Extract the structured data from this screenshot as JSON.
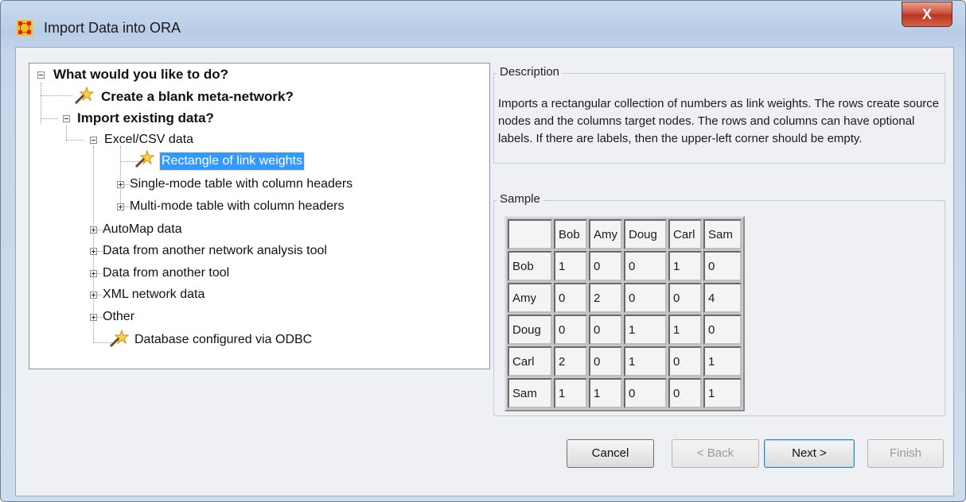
{
  "window": {
    "title": "Import Data into ORA",
    "close_label": "X"
  },
  "tree": {
    "root": "What would you like to do?",
    "create_blank": "Create a blank meta-network?",
    "import_existing": "Import existing data?",
    "excel_csv": "Excel/CSV data",
    "rect_link_weights": "Rectangle of link weights",
    "single_mode": "Single-mode table with column headers",
    "multi_mode": "Multi-mode table with column headers",
    "automap": "AutoMap data",
    "other_network_tool": "Data from another network analysis tool",
    "other_tool": "Data from another tool",
    "xml_network": "XML network data",
    "other": "Other",
    "odbc": "Database configured via ODBC"
  },
  "description": {
    "label": "Description",
    "text": "Imports a rectangular collection of numbers as link weights. The rows create source nodes and the columns target nodes. The rows and columns can have optional labels. If there are labels, then the upper-left corner should be empty."
  },
  "sample": {
    "label": "Sample",
    "columns": [
      "",
      "Bob",
      "Amy",
      "Doug",
      "Carl",
      "Sam"
    ],
    "rows": [
      [
        "Bob",
        "1",
        "0",
        "0",
        "1",
        "0"
      ],
      [
        "Amy",
        "0",
        "2",
        "0",
        "0",
        "4"
      ],
      [
        "Doug",
        "0",
        "0",
        "1",
        "1",
        "0"
      ],
      [
        "Carl",
        "2",
        "0",
        "1",
        "0",
        "1"
      ],
      [
        "Sam",
        "1",
        "1",
        "0",
        "0",
        "1"
      ]
    ]
  },
  "buttons": {
    "cancel": "Cancel",
    "back": "< Back",
    "next": "Next >",
    "finish": "Finish"
  }
}
